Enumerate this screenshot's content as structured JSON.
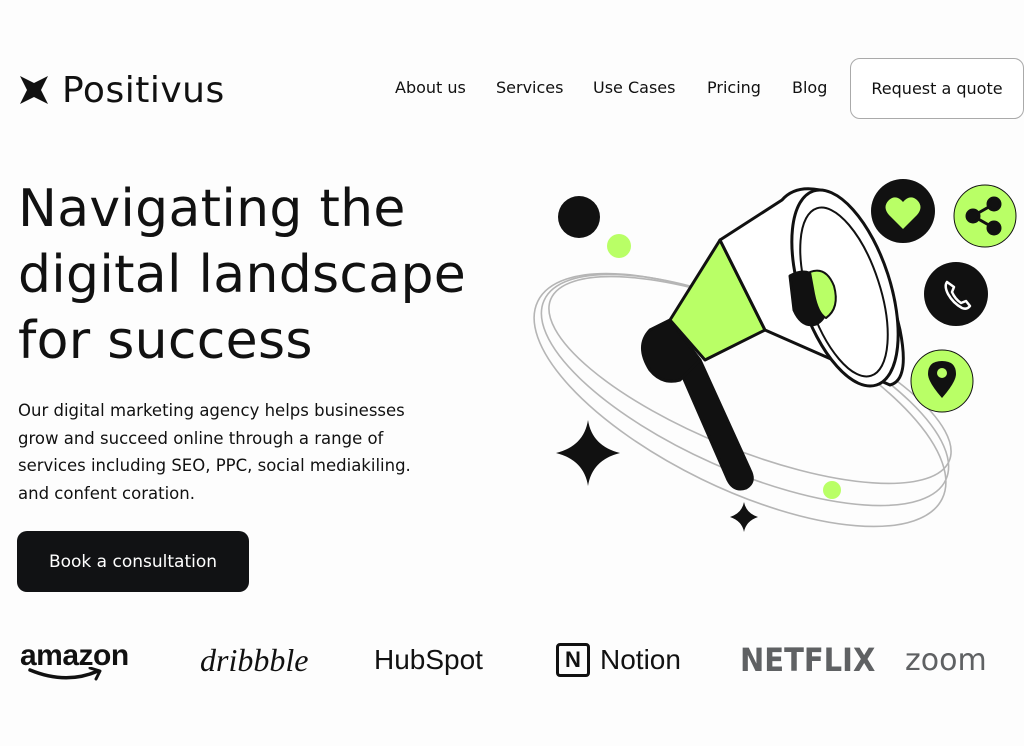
{
  "brand": {
    "name": "Positivus",
    "icon": "star-burst-icon"
  },
  "nav": {
    "items": [
      {
        "label": "About us"
      },
      {
        "label": "Services"
      },
      {
        "label": "Use Cases"
      },
      {
        "label": "Pricing"
      },
      {
        "label": "Blog"
      }
    ],
    "cta_label": "Request a quote"
  },
  "hero": {
    "title_lines": [
      "Navigating the",
      "digital landscape",
      "for success"
    ],
    "description_lines": [
      "Our digital marketing agency helps businesses",
      "grow and succeed online through a range of",
      "services including SEO, PPC, social mediakiling.",
      "and confent coration."
    ],
    "cta_label": "Book a consultation",
    "illustration": {
      "icons": [
        "megaphone-icon",
        "heart-icon",
        "share-icon",
        "phone-icon",
        "location-pin-icon",
        "sparkle-icon"
      ]
    }
  },
  "logos": [
    "amazon",
    "dribbble",
    "HubSpot",
    "Notion",
    "NETFLIX",
    "zoom"
  ],
  "colors": {
    "accent": "#b9ff66",
    "dark": "#191a23",
    "text": "#111111",
    "muted_logo": "#5f6163"
  }
}
